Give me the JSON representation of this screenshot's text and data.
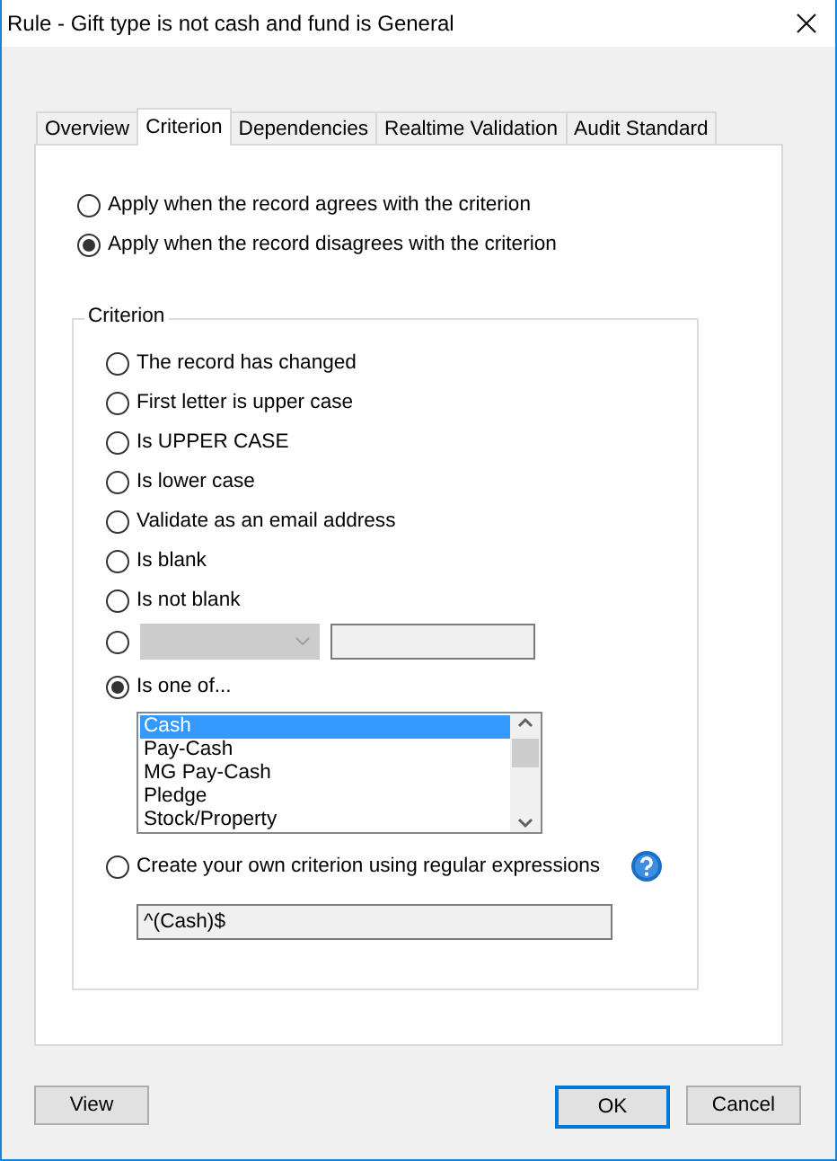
{
  "window": {
    "title": "Rule - Gift type is not cash and fund is General"
  },
  "tabs": [
    {
      "label": "Overview",
      "selected": false
    },
    {
      "label": "Criterion",
      "selected": true
    },
    {
      "label": "Dependencies",
      "selected": false
    },
    {
      "label": "Realtime Validation",
      "selected": false
    },
    {
      "label": "Audit Standard",
      "selected": false
    }
  ],
  "apply_options": [
    {
      "label": "Apply when the record agrees with the criterion",
      "selected": false
    },
    {
      "label": "Apply when the record disagrees with the criterion",
      "selected": true
    }
  ],
  "criterion": {
    "title": "Criterion",
    "options": [
      {
        "kind": "radio",
        "label": "The record has changed",
        "selected": false
      },
      {
        "kind": "radio",
        "label": "First letter is upper case",
        "selected": false
      },
      {
        "kind": "radio",
        "label": "Is UPPER CASE",
        "selected": false
      },
      {
        "kind": "radio",
        "label": "Is lower case",
        "selected": false
      },
      {
        "kind": "radio",
        "label": "Validate as an email address",
        "selected": false
      },
      {
        "kind": "radio",
        "label": "Is blank",
        "selected": false
      },
      {
        "kind": "radio",
        "label": "Is not blank",
        "selected": false
      },
      {
        "kind": "combo",
        "selected": false,
        "disabled": true
      },
      {
        "kind": "list",
        "label": "Is one of...",
        "selected": true,
        "items": [
          {
            "label": "Cash",
            "selected": true
          },
          {
            "label": "Pay-Cash",
            "selected": false
          },
          {
            "label": "MG Pay-Cash",
            "selected": false
          },
          {
            "label": "Pledge",
            "selected": false
          },
          {
            "label": "Stock/Property",
            "selected": false
          }
        ]
      },
      {
        "kind": "regex",
        "label": "Create your own criterion using regular expressions",
        "selected": false,
        "value": "^(Cash)$",
        "disabled": true
      }
    ]
  },
  "footer": {
    "left": [
      {
        "label": "View",
        "default": false
      }
    ],
    "right": [
      {
        "label": "OK",
        "default": true
      },
      {
        "label": "Cancel",
        "default": false
      }
    ]
  }
}
